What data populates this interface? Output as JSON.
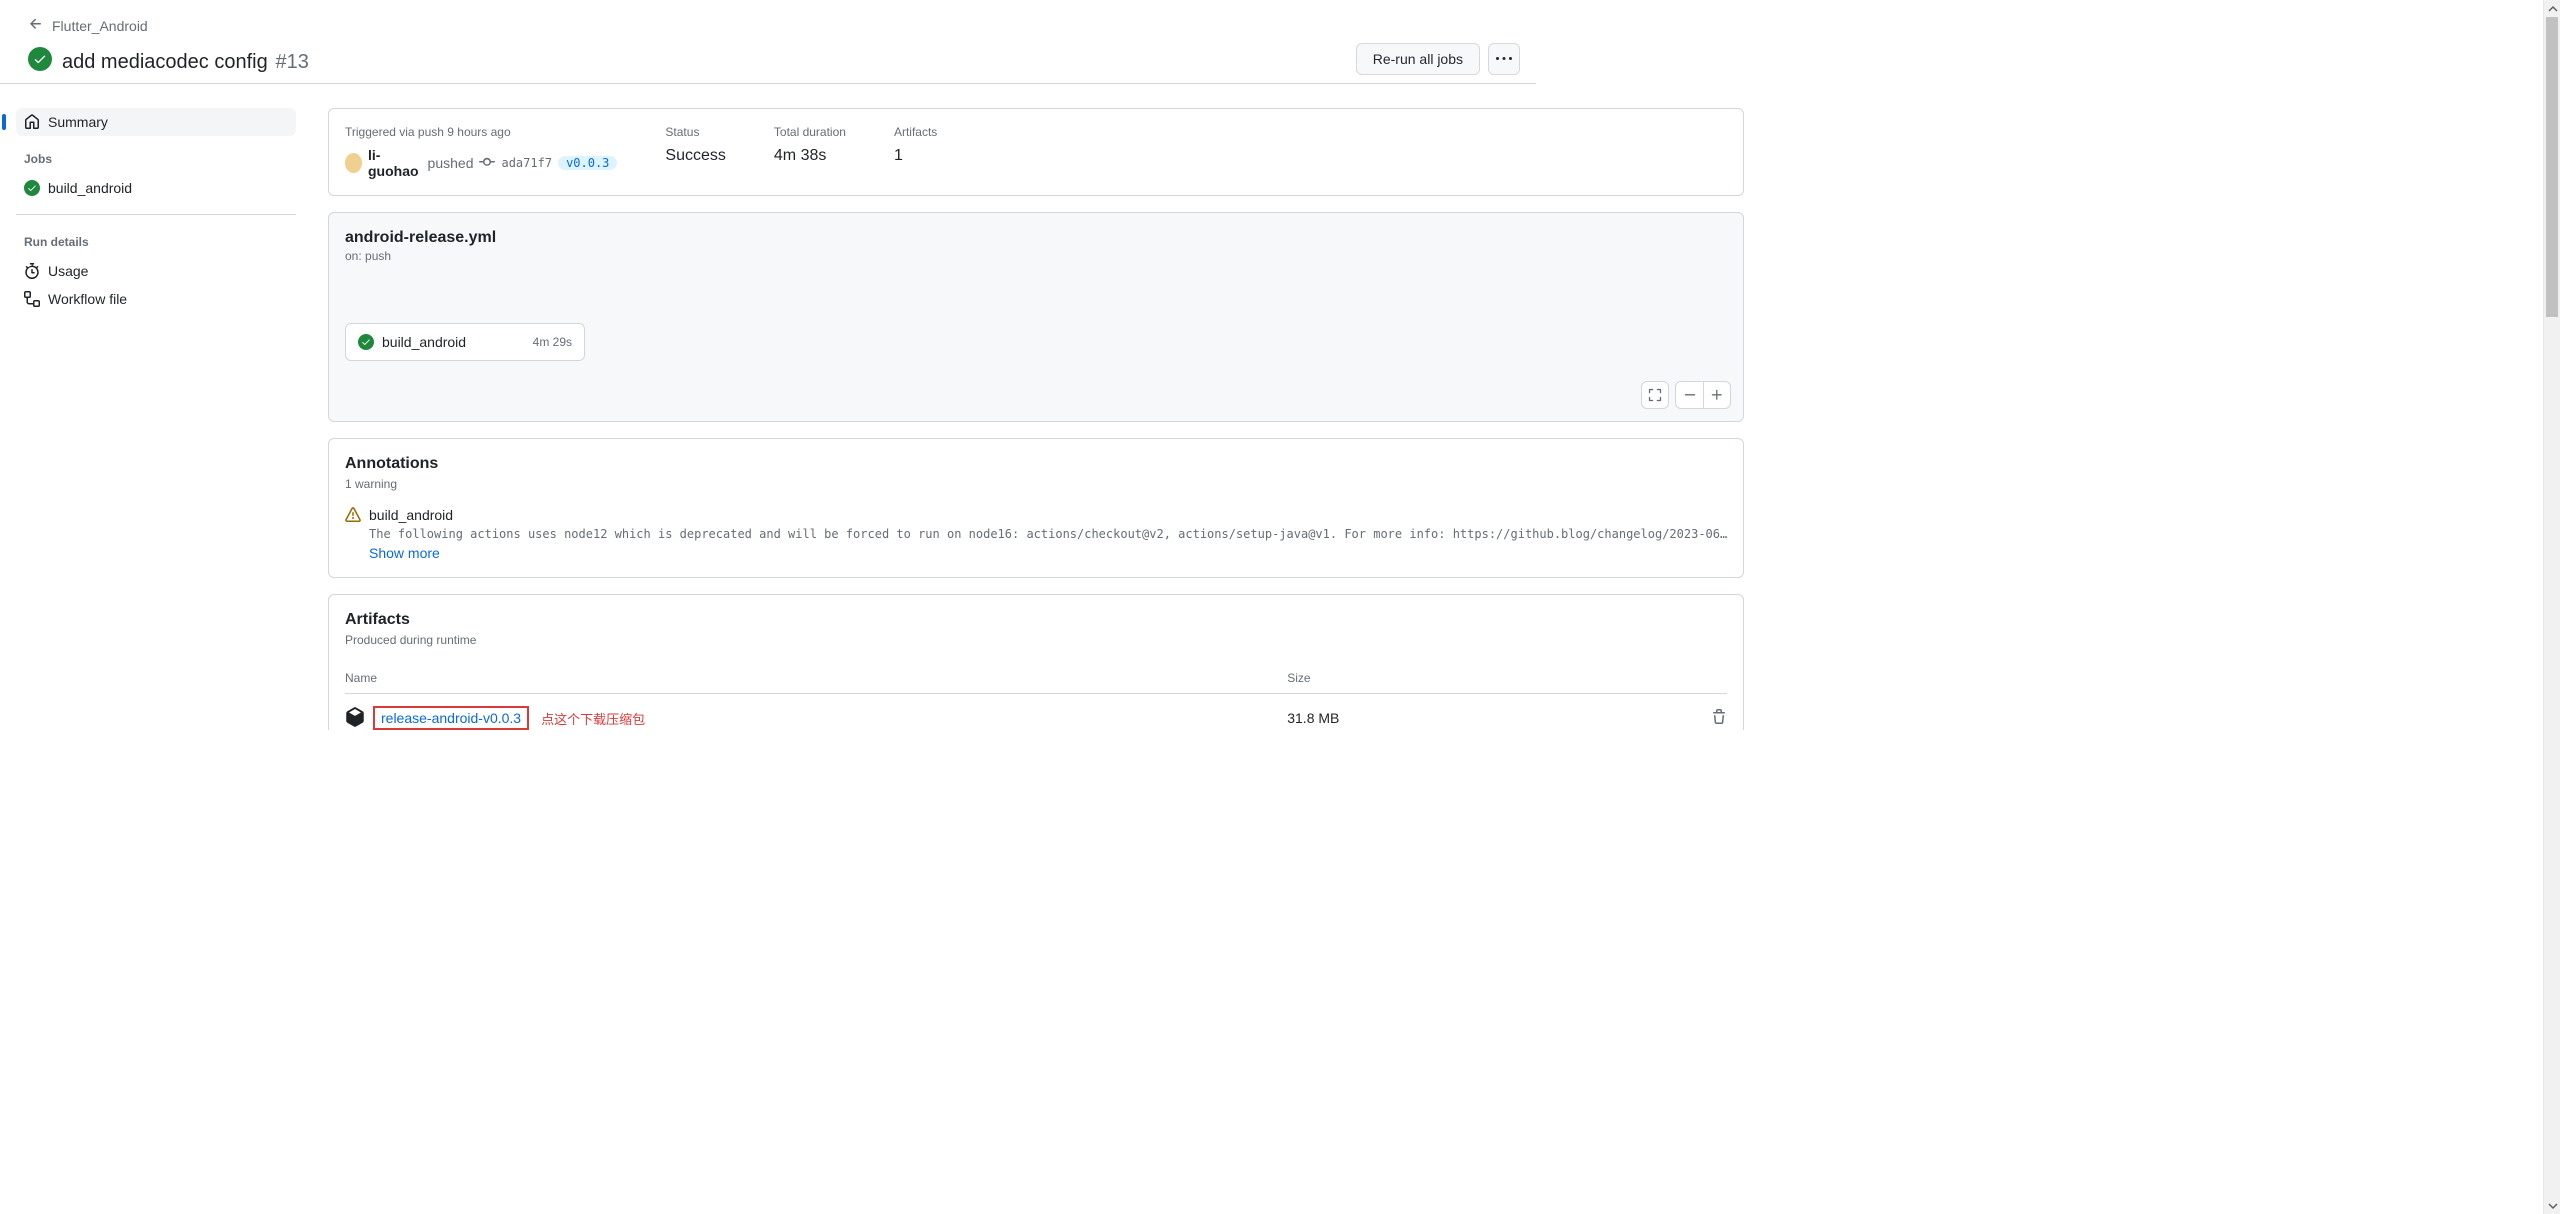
{
  "breadcrumb": {
    "parent": "Flutter_Android"
  },
  "title": {
    "text": "add mediacodec config",
    "number": "#13"
  },
  "actions": {
    "rerun": "Re-run all jobs"
  },
  "sidebar": {
    "summary": "Summary",
    "jobs_heading": "Jobs",
    "jobs": [
      {
        "name": "build_android"
      }
    ],
    "run_details_heading": "Run details",
    "usage": "Usage",
    "workflow_file": "Workflow file"
  },
  "summary": {
    "triggered_label": "Triggered via push 9 hours ago",
    "actor": "li-guohao",
    "action": "pushed",
    "commit": "ada71f7",
    "tag": "v0.0.3",
    "status_label": "Status",
    "status_value": "Success",
    "duration_label": "Total duration",
    "duration_value": "4m 38s",
    "artifacts_label": "Artifacts",
    "artifacts_value": "1"
  },
  "workflow": {
    "file": "android-release.yml",
    "trigger": "on: push",
    "job": {
      "name": "build_android",
      "duration": "4m 29s"
    }
  },
  "annotations": {
    "title": "Annotations",
    "count": "1 warning",
    "items": [
      {
        "title": "build_android",
        "body": "The following actions uses node12 which is deprecated and will be forced to run on node16: actions/checkout@v2, actions/setup-java@v1. For more info: https://github.blog/changelog/2023-06…"
      }
    ],
    "show_more": "Show more"
  },
  "artifacts": {
    "title": "Artifacts",
    "subtitle": "Produced during runtime",
    "col_name": "Name",
    "col_size": "Size",
    "items": [
      {
        "name": "release-android-v0.0.3",
        "size": "31.8 MB"
      }
    ],
    "red_note": "点这个下载压缩包"
  }
}
